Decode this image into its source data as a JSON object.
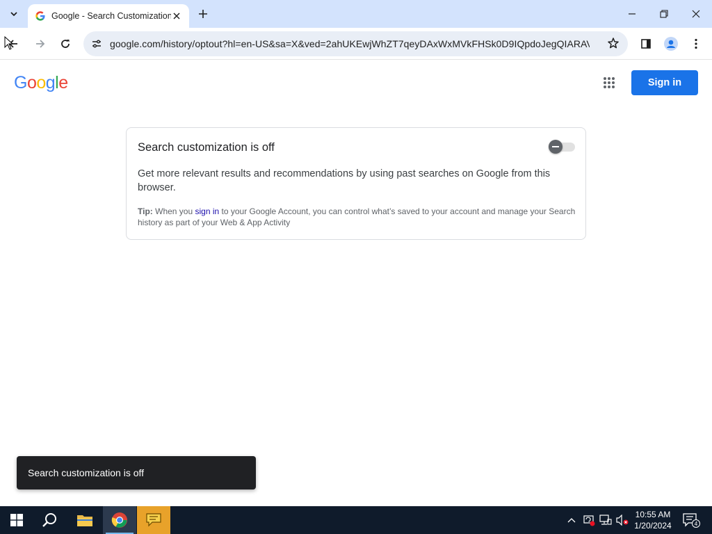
{
  "browser": {
    "tab_title": "Google - Search Customization",
    "url": "google.com/history/optout?hl=en-US&sa=X&ved=2ahUKEwjWhZT7qeyDAxWxMVkFHSk0D9IQpdoJegQIARAV"
  },
  "page": {
    "logo": {
      "letters": [
        "G",
        "o",
        "o",
        "g",
        "l",
        "e"
      ],
      "colors": [
        "#4285F4",
        "#EA4335",
        "#FBBC05",
        "#4285F4",
        "#34A853",
        "#EA4335"
      ]
    },
    "signin_label": "Sign in",
    "card": {
      "heading": "Search customization is off",
      "toggle_on": false,
      "description": "Get more relevant results and recommendations by using past searches on Google from this browser.",
      "tip_label": "Tip:",
      "tip_before": " When you ",
      "tip_link": "sign in",
      "tip_after": " to your Google Account, you can control what’s saved to your account and manage your Search history as part of your Web & App Activity"
    },
    "snackbar": "Search customization is off"
  },
  "taskbar": {
    "time": "10:55 AM",
    "date": "1/20/2024",
    "notification_count": "4"
  },
  "colors": {
    "accent": "#1a73e8",
    "tabstrip": "#d3e3fd",
    "taskbar": "#0f1b2b"
  }
}
